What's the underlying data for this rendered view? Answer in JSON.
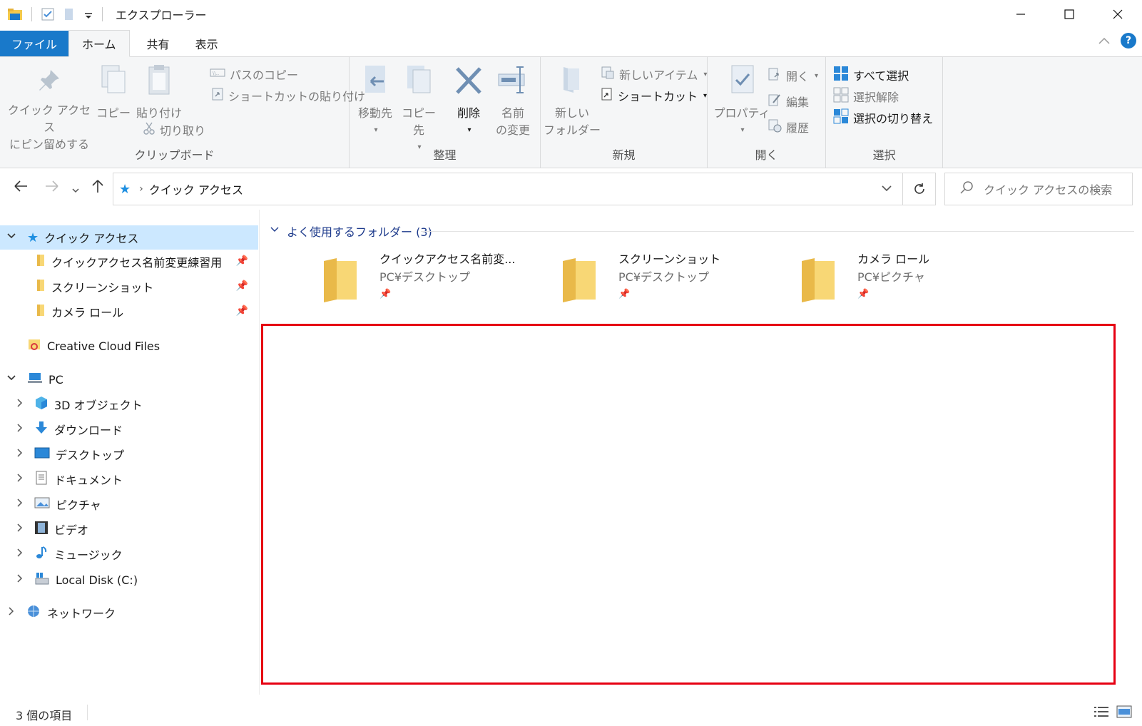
{
  "window": {
    "title": "エクスプローラー",
    "minimize": "—",
    "maximize": "☐",
    "close": "✕"
  },
  "ribbon_tabs": [
    {
      "label": "ファイル"
    },
    {
      "label": "ホーム"
    },
    {
      "label": "共有"
    },
    {
      "label": "表示"
    }
  ],
  "ribbon": {
    "clipboard": {
      "label": "クリップボード",
      "pin_quick_access_line1": "クイック アクセス",
      "pin_quick_access_line2": "にピン留めする",
      "copy": "コピー",
      "paste": "貼り付け",
      "copy_path": "パスのコピー",
      "paste_shortcut": "ショートカットの貼り付け",
      "cut": "切り取り"
    },
    "organize": {
      "label": "整理",
      "move_to": "移動先",
      "copy_to": "コピー先",
      "delete": "削除",
      "rename_line1": "名前",
      "rename_line2": "の変更"
    },
    "new": {
      "label": "新規",
      "new_folder_line1": "新しい",
      "new_folder_line2": "フォルダー",
      "new_item": "新しいアイテム",
      "shortcut": "ショートカット"
    },
    "open": {
      "label": "開く",
      "properties": "プロパティ",
      "open": "開く",
      "edit": "編集",
      "history": "履歴"
    },
    "select": {
      "label": "選択",
      "select_all": "すべて選択",
      "select_none": "選択解除",
      "invert_selection": "選択の切り替え"
    }
  },
  "address": {
    "crumb": "クイック アクセス",
    "search_placeholder": "クイック アクセスの検索"
  },
  "nav_pane": {
    "quick_access": "クイック アクセス",
    "pinned": [
      "クイックアクセス名前変更練習用",
      "スクリーンショット",
      "カメラ ロール"
    ],
    "creative_cloud": "Creative Cloud Files",
    "pc": "PC",
    "pc_children": [
      "3D オブジェクト",
      "ダウンロード",
      "デスクトップ",
      "ドキュメント",
      "ピクチャ",
      "ビデオ",
      "ミュージック",
      "Local Disk (C:)"
    ],
    "network": "ネットワーク"
  },
  "content": {
    "section_title": "よく使用するフォルダー (3)",
    "folders": [
      {
        "name": "クイックアクセス名前変...",
        "path": "PC¥デスクトップ"
      },
      {
        "name": "スクリーンショット",
        "path": "PC¥デスクトップ"
      },
      {
        "name": "カメラ ロール",
        "path": "PC¥ピクチャ"
      }
    ]
  },
  "status": {
    "item_count": "3 個の項目"
  },
  "colors": {
    "accent": "#1979ca",
    "selection": "#cce8ff",
    "highlight_box": "#e60012",
    "folder": "#f8d775"
  }
}
